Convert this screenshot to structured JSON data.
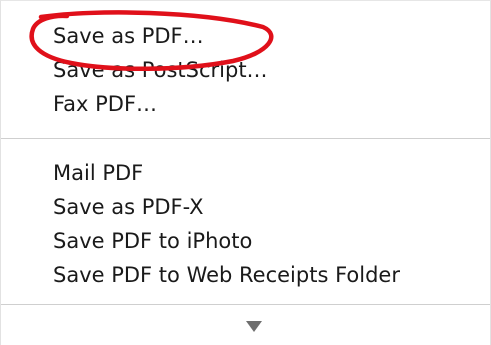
{
  "menu": {
    "group1": [
      {
        "label": "Save as PDF…"
      },
      {
        "label": "Save as PostScript…"
      },
      {
        "label": "Fax PDF…"
      }
    ],
    "group2": [
      {
        "label": "Mail PDF"
      },
      {
        "label": "Save as PDF-X"
      },
      {
        "label": "Save PDF to iPhoto"
      },
      {
        "label": "Save PDF to Web Receipts Folder"
      }
    ]
  },
  "scroll_icon": "triangle-down-icon",
  "annotation_color": "#e0101a",
  "arrow_color": "#6e6e6e",
  "separator_color": "#cfcfcf"
}
